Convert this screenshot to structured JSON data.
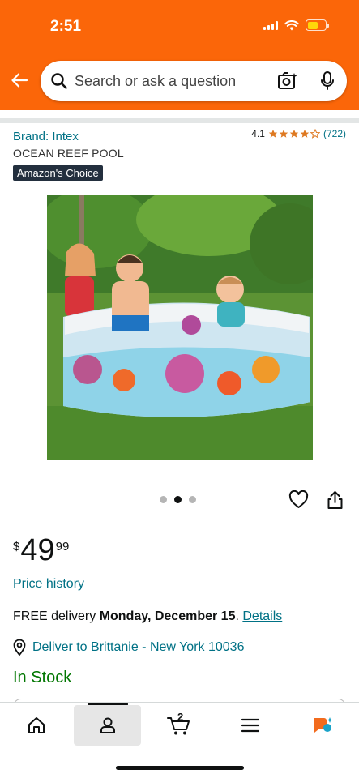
{
  "status_bar": {
    "time": "2:51"
  },
  "search": {
    "placeholder": "Search or ask a question"
  },
  "product": {
    "brand": "Brand: Intex",
    "title": "OCEAN REEF POOL",
    "badge": "Amazon's Choice",
    "rating": "4.1",
    "rating_value": 4.1,
    "rating_max": 5,
    "review_count": "(722)",
    "image_count": 3,
    "active_image_index": 1
  },
  "price": {
    "currency": "$",
    "whole": "49",
    "fraction": "99"
  },
  "price_history_label": "Price history",
  "delivery": {
    "prefix": "FREE delivery ",
    "date": "Monday, December 15",
    "suffix": ". ",
    "details_label": "Details"
  },
  "deliver_to": "Deliver to Brittanie - New York 10036",
  "stock_status": "In Stock",
  "tab_bar": {
    "items": [
      {
        "icon": "home-icon",
        "active": false
      },
      {
        "icon": "account-icon",
        "active": true
      },
      {
        "icon": "cart-icon",
        "active": false,
        "count": "2"
      },
      {
        "icon": "menu-icon",
        "active": false
      },
      {
        "icon": "rufus-icon",
        "active": false
      }
    ]
  },
  "colors": {
    "header": "#fb6609",
    "link": "#007185",
    "star": "#de7921",
    "in_stock": "#007600",
    "badge_bg": "#232f3e"
  }
}
